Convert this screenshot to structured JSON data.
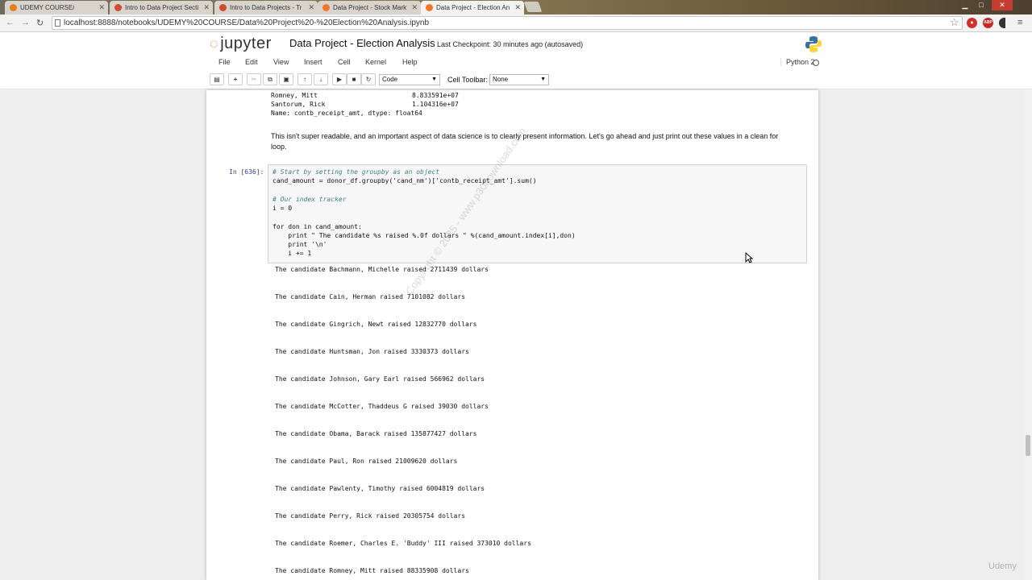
{
  "browser": {
    "tabs": [
      {
        "label": "UDEMY COURSE/",
        "color": "#e87c1e"
      },
      {
        "label": "Intro to Data Project Secti",
        "color": "#d24a2f"
      },
      {
        "label": "Intro to Data Projects - Tr",
        "color": "#d24a2f"
      },
      {
        "label": "Data Project - Stock Mark",
        "color": "#f37726"
      },
      {
        "label": "Data Project - Election An",
        "color": "#f37726"
      }
    ],
    "url": "localhost:8888/notebooks/UDEMY%20COURSE/Data%20Project%20-%20Election%20Analysis.ipynb",
    "extensions": [
      "stop",
      "ABP",
      "ext"
    ]
  },
  "header": {
    "logo": "jupyter",
    "title": "Data Project - Election Analysis",
    "checkpoint": "Last Checkpoint: 30 minutes ago (autosaved)",
    "kernel": "Python 2"
  },
  "menu": [
    "File",
    "Edit",
    "View",
    "Insert",
    "Cell",
    "Kernel",
    "Help"
  ],
  "toolbar": {
    "buttons": [
      "save",
      "add",
      "cut",
      "copy",
      "paste",
      "up",
      "down",
      "run",
      "stop",
      "restart"
    ],
    "cell_type": "Code",
    "cell_toolbar_label": "Cell Toolbar:",
    "cell_toolbar_value": "None"
  },
  "prev_output": {
    "rows": [
      {
        "name": "Romney, Mitt",
        "value": "8.833591e+07"
      },
      {
        "name": "Santorum, Rick",
        "value": "1.104316e+07"
      }
    ],
    "footer": "Name: contb_receipt_amt, dtype: float64"
  },
  "markdown": "This isn't super readable, and an important aspect of data science is to clearly present information. Let's go ahead and just print out these values in a clean for loop.",
  "cell": {
    "prompt": "In [636]:",
    "code": [
      "# Start by setting the groupby as an object",
      "cand_amount = donor_df.groupby('cand_nm')['contb_receipt_amt'].sum()",
      "",
      "# Our index tracker",
      "i = 0",
      "",
      "for don in cand_amount:",
      "    print \" The candidate %s raised %.0f dollars \" %(cand_amount.index[i],don)",
      "    print '\\n'",
      "    i += 1"
    ]
  },
  "output": [
    "The candidate Bachmann, Michelle raised 2711439 dollars",
    "The candidate Cain, Herman raised 7101082 dollars",
    "The candidate Gingrich, Newt raised 12832770 dollars",
    "The candidate Huntsman, Jon raised 3330373 dollars",
    "The candidate Johnson, Gary Earl raised 566962 dollars",
    "The candidate McCotter, Thaddeus G raised 39030 dollars",
    "The candidate Obama, Barack raised 135877427 dollars",
    "The candidate Paul, Ron raised 21009620 dollars",
    "The candidate Pawlenty, Timothy raised 6004819 dollars",
    "The candidate Perry, Rick raised 20305754 dollars",
    "The candidate Roemer, Charles E. 'Buddy' III raised 373010 dollars",
    "The candidate Romney, Mitt raised 88335908 dollars"
  ],
  "watermark": "Copyright © 2025 - www.p30download.com",
  "udemy_mark": "Udemy"
}
